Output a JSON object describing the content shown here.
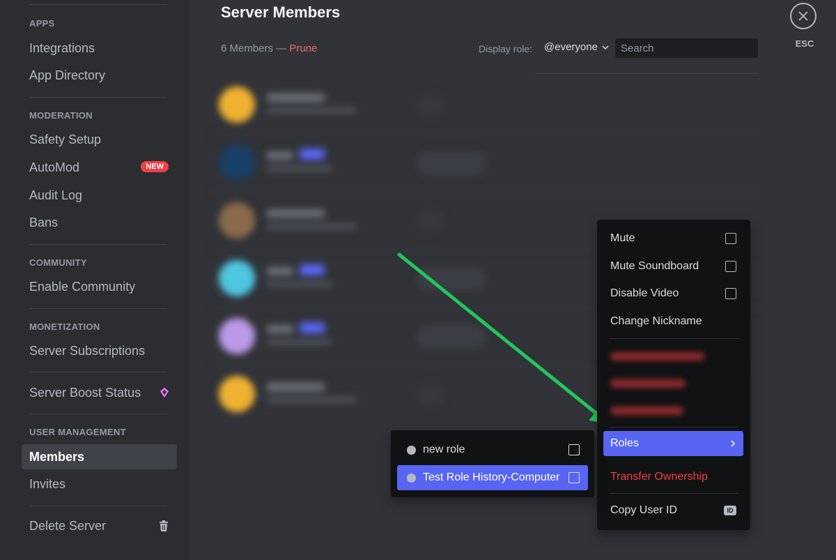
{
  "sidebar": {
    "sections": [
      {
        "label": "APPS"
      },
      {
        "label": "MODERATION"
      },
      {
        "label": "COMMUNITY"
      },
      {
        "label": "MONETIZATION"
      },
      {
        "label": "USER MANAGEMENT"
      }
    ],
    "items": {
      "integrations": "Integrations",
      "app_directory": "App Directory",
      "safety_setup": "Safety Setup",
      "automod": "AutoMod",
      "automod_badge": "NEW",
      "audit_log": "Audit Log",
      "bans": "Bans",
      "enable_community": "Enable Community",
      "server_subscriptions": "Server Subscriptions",
      "server_boost_status": "Server Boost Status",
      "members": "Members",
      "invites": "Invites",
      "delete_server": "Delete Server"
    }
  },
  "header": {
    "title": "Server Members",
    "member_count": "6 Members — ",
    "prune_label": "Prune",
    "display_role_label": "Display role:",
    "display_role_value": "@everyone",
    "search_placeholder": "Search"
  },
  "close": {
    "esc_label": "ESC"
  },
  "context_menu": {
    "mute": "Mute",
    "mute_soundboard": "Mute Soundboard",
    "disable_video": "Disable Video",
    "change_nickname": "Change Nickname",
    "roles": "Roles",
    "transfer_ownership": "Transfer Ownership",
    "copy_user_id": "Copy User ID",
    "id_badge": "ID"
  },
  "roles_submenu": {
    "items": [
      {
        "label": "new role",
        "checked": false,
        "selected": false
      },
      {
        "label": "Test Role History-Computer",
        "checked": false,
        "selected": true
      }
    ]
  },
  "colors": {
    "accent": "#5865f2",
    "danger": "#f23f43",
    "annotation_arrow": "#22c55e",
    "prune": "#f26f5b"
  }
}
